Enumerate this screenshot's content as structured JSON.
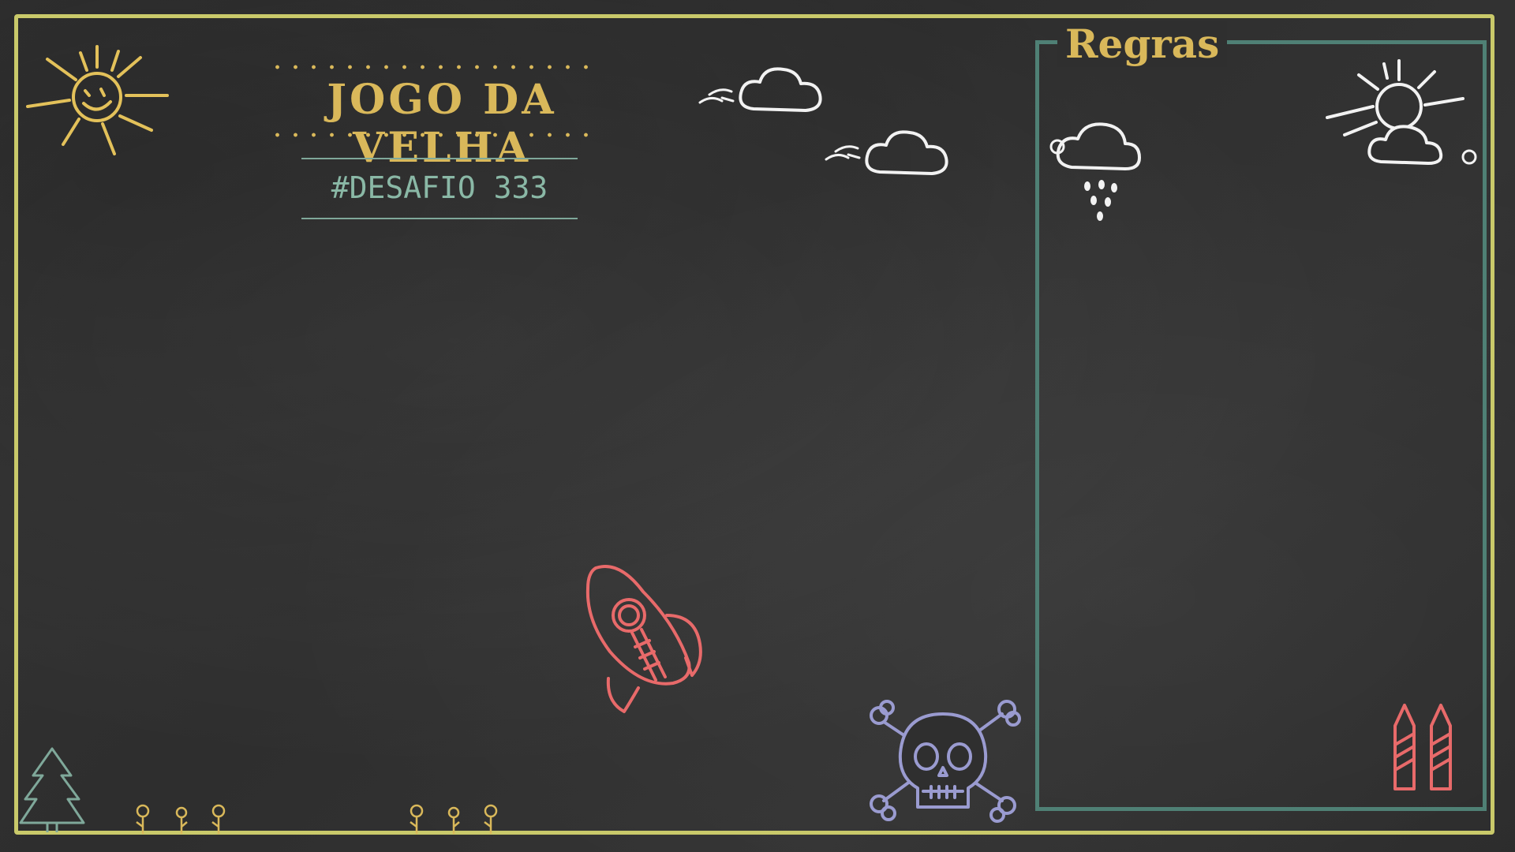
{
  "header": {
    "title": "JOGO DA VELHA",
    "subtitle": "#DESAFIO 333"
  },
  "rules": {
    "title": "Regras"
  },
  "colors": {
    "frame": "#c9c96a",
    "gold": "#d9b85a",
    "teal": "#4f8075",
    "mint": "#8ab8a6",
    "chalk_white": "#f2f2f2",
    "red": "#e86a6a",
    "lavender": "#9a9bd0",
    "board": "#2f2f2f"
  },
  "doodles": [
    "sun-icon",
    "cloud-icon",
    "rain-cloud-icon",
    "sun-cloud-icon",
    "rocket-icon",
    "skull-crossbones-icon",
    "tree-icon",
    "flower-icon",
    "crayon-icon"
  ]
}
